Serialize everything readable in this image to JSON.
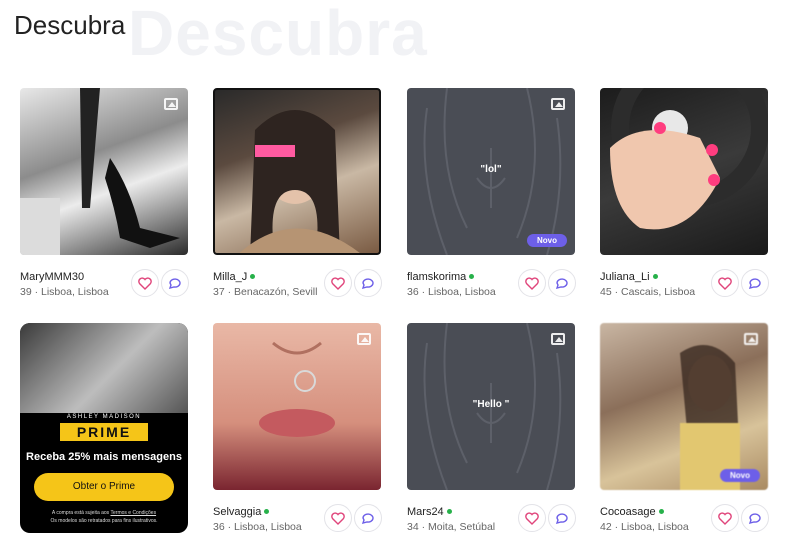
{
  "header": {
    "title": "Descubra",
    "watermark": "Descubra"
  },
  "profiles": [
    {
      "name": "MaryMMM30",
      "online": false,
      "meta": "39 · Lisboa, Lisboa",
      "photo": "photo",
      "badge": ""
    },
    {
      "name": "Milla_J",
      "online": true,
      "meta": "37 · Benacazón, Sevill",
      "photo": "photo",
      "badge": ""
    },
    {
      "name": "flamskorima",
      "online": true,
      "meta": "36 · Lisboa, Lisboa",
      "photo": "silhouette",
      "caption": "\"lol\"",
      "badge": "Novo"
    },
    {
      "name": "Juliana_Li",
      "online": true,
      "meta": "45 · Cascais, Lisboa",
      "photo": "photo",
      "badge": ""
    },
    {
      "name": "Selvaggia",
      "online": true,
      "meta": "36 · Lisboa, Lisboa",
      "photo": "photo",
      "badge": ""
    },
    {
      "name": "Mars24",
      "online": true,
      "meta": "34 · Moita, Setúbal",
      "photo": "silhouette",
      "caption": "\"Hello \"",
      "badge": ""
    },
    {
      "name": "Cocoasage",
      "online": true,
      "meta": "42 · Lisboa, Lisboa",
      "photo": "photo",
      "badge": "Novo"
    }
  ],
  "promo": {
    "brand": "ASHLEY MADISON",
    "prime": "PRIME",
    "headline": "Receba 25% mais mensagens",
    "button": "Obter o Prime",
    "fine_print_a": "A compra está sujeita aos",
    "fine_print_link": "Termos e Condições",
    "fine_print_b": "Os modelos são retratados para fins ilustrativos."
  },
  "colors": {
    "accent": "#6d5fe8",
    "like": "#e0457b",
    "online": "#27b14a",
    "prime": "#f5c518",
    "silhouette": "#4a4d55"
  }
}
